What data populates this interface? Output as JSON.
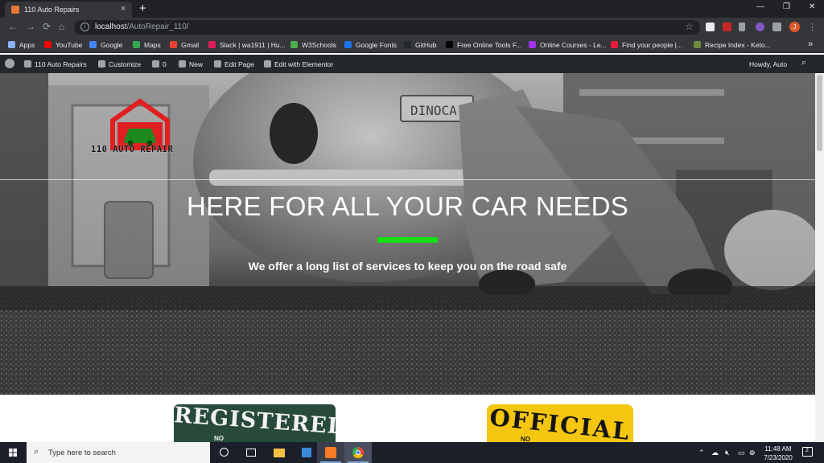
{
  "browser": {
    "tab_title": "110 Auto Repairs",
    "tab_close": "×",
    "new_tab": "+",
    "url_host": "localhost",
    "url_path": "/AutoRepair_110/",
    "window_controls": [
      "—",
      "❐",
      "✕"
    ],
    "nav": [
      "←",
      "→",
      "⟳",
      "⌂"
    ],
    "profile_initial": "J"
  },
  "bookmarks": [
    {
      "label": "Apps",
      "color": "#8ab4f8"
    },
    {
      "label": "YouTube",
      "color": "#ff0000"
    },
    {
      "label": "Google",
      "color": "#4285f4"
    },
    {
      "label": "Maps",
      "color": "#34a853"
    },
    {
      "label": "Gmail",
      "color": "#ea4335"
    },
    {
      "label": "Slack | wa1911 | Hu...",
      "color": "#e01e5a"
    },
    {
      "label": "W3Schools",
      "color": "#4caf50"
    },
    {
      "label": "Google Fonts",
      "color": "#1a73e8"
    },
    {
      "label": "GitHub",
      "color": "#24292e"
    },
    {
      "label": "Free Online Tools F...",
      "color": "#000000"
    },
    {
      "label": "Online Courses - Le...",
      "color": "#a435f0"
    },
    {
      "label": "Find your people |...",
      "color": "#ed1c40"
    },
    {
      "label": "Recipe Index - Keto...",
      "color": "#6d8b3a"
    }
  ],
  "bookmarks_more": "»",
  "adminbar": {
    "site_name": "110 Auto Repairs",
    "customize": "Customize",
    "comments_count": "0",
    "new": "New",
    "edit_page": "Edit Page",
    "edit_elementor": "Edit with Elementor",
    "howdy": "Howdy, Auto"
  },
  "hero": {
    "logo_text": "110 AUTO REPAIR",
    "title": "HERE FOR ALL YOUR CAR NEEDS",
    "subtitle": "We offer a long list of services to keep you on the road safe",
    "accent_color": "#15e015"
  },
  "badges": {
    "registered": "REGISTERED",
    "registered_small": "NO",
    "official": "OFFICIAL",
    "official_small": "NO"
  },
  "taskbar": {
    "search_placeholder": "Type here to search",
    "time": "11:48 AM",
    "date": "7/23/2020"
  }
}
